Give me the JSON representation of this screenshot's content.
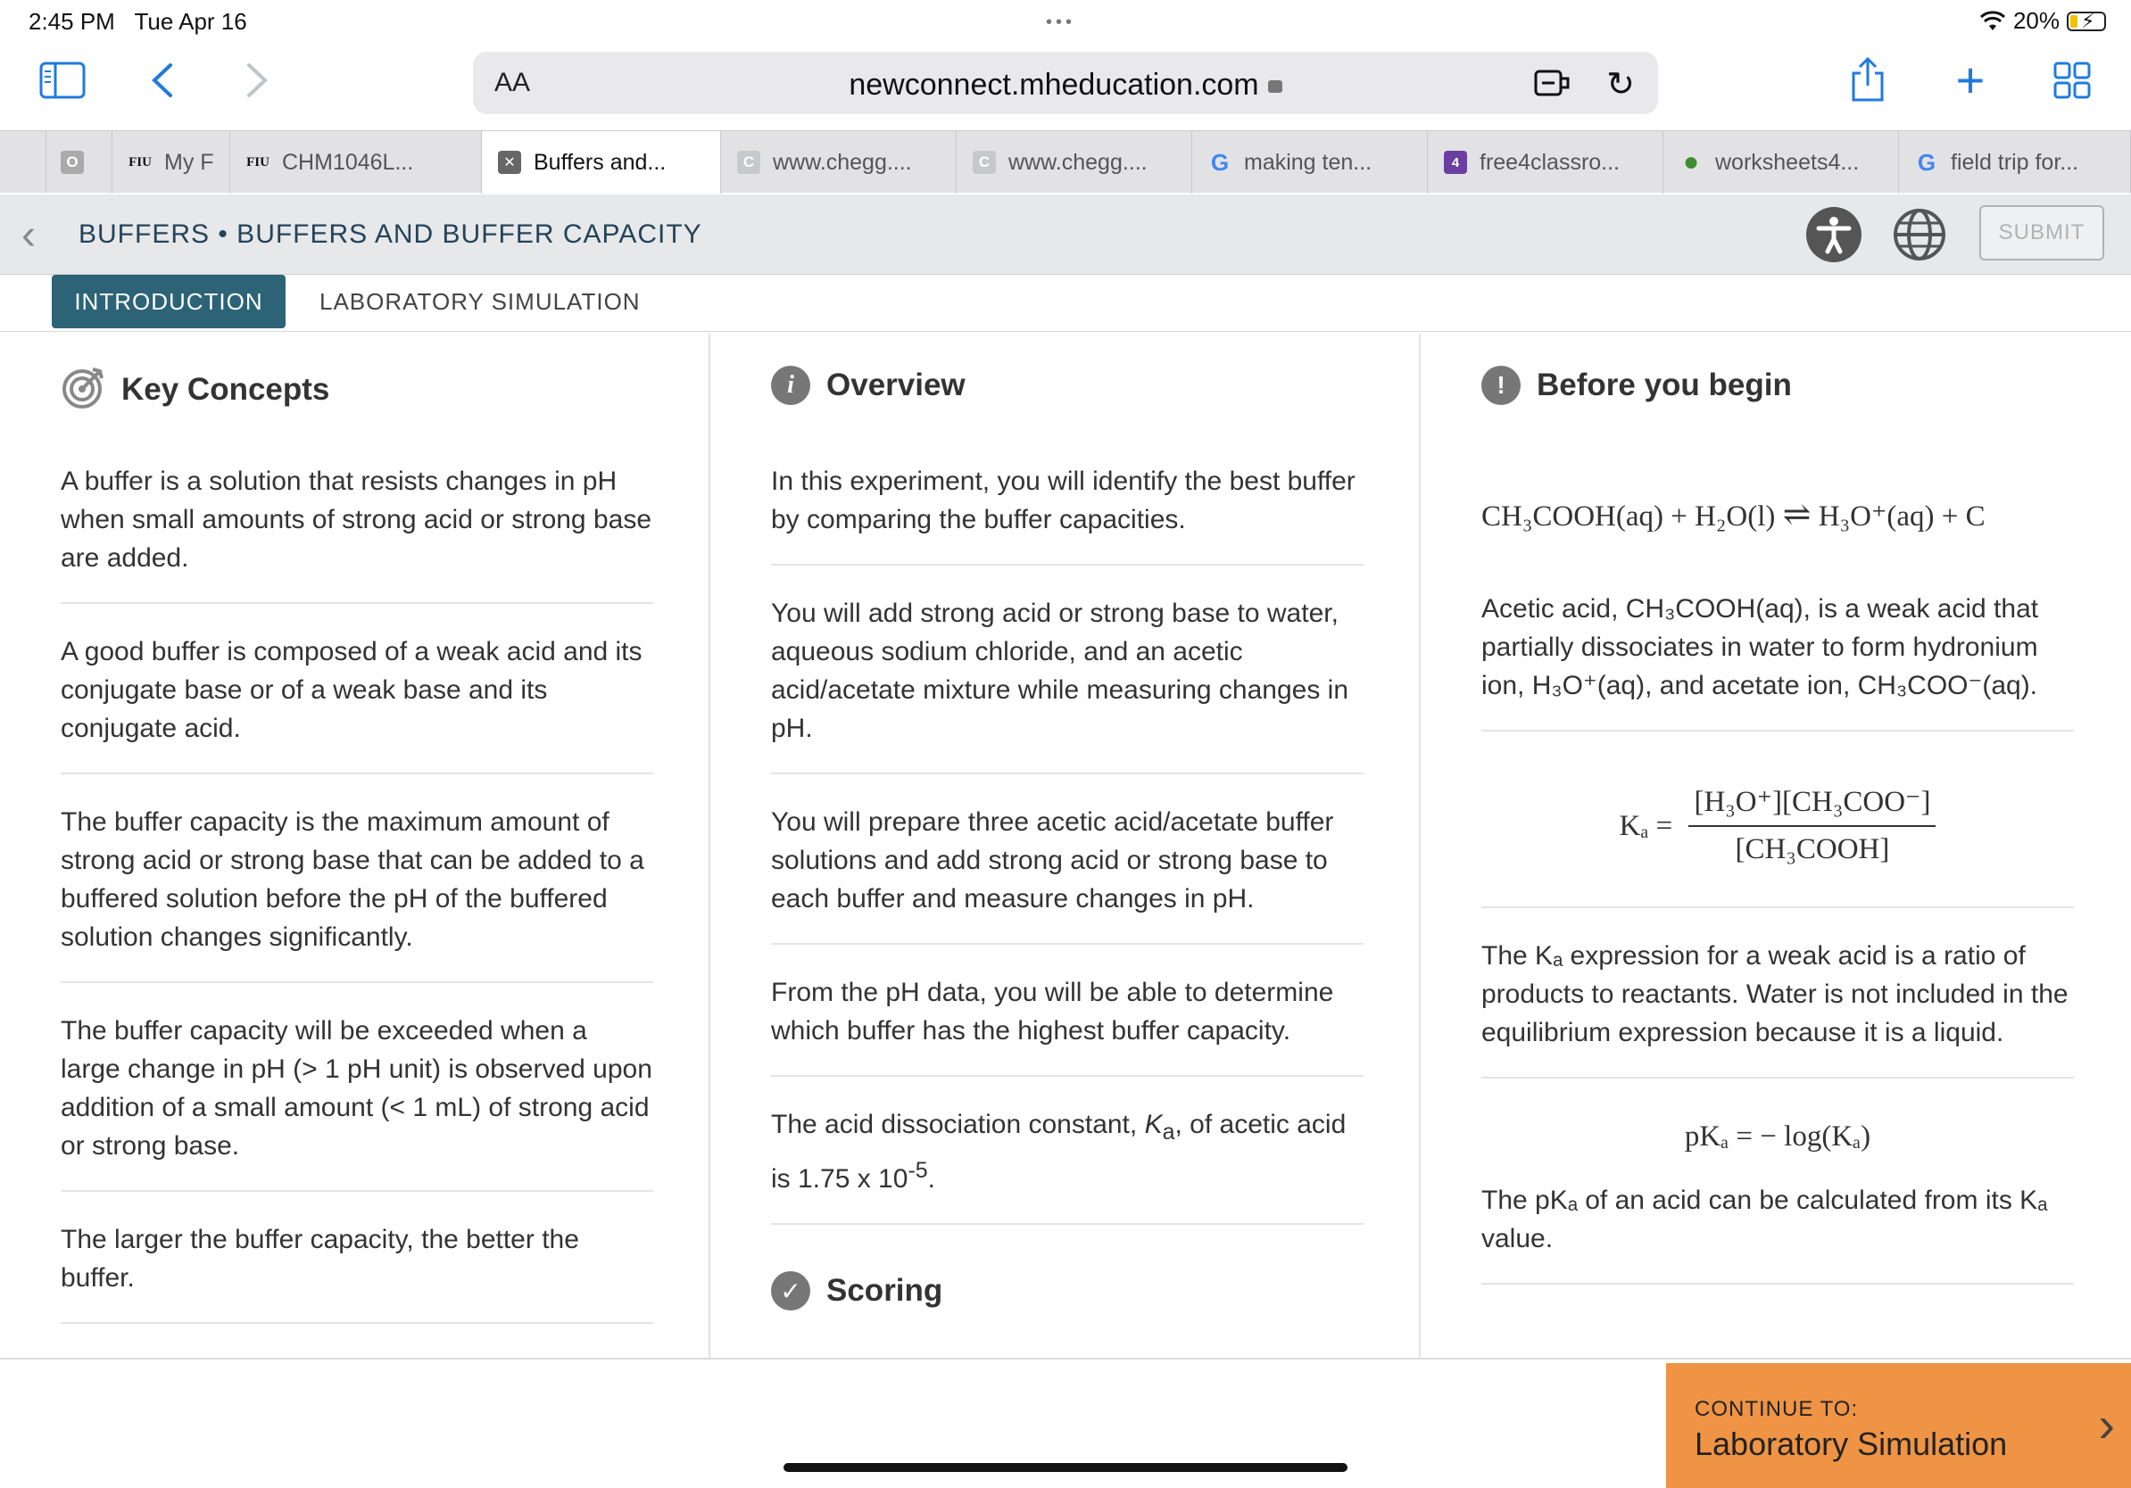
{
  "status": {
    "time": "2:45 PM",
    "date": "Tue Apr 16",
    "battery": "20%"
  },
  "browser": {
    "aa_label": "AA",
    "url": "newconnect.mheducation.com",
    "tabs": [
      {
        "favicon": "O",
        "label": ""
      },
      {
        "favicon": "FIU",
        "label": "My F"
      },
      {
        "favicon": "FIU",
        "label": "CHM1046L..."
      },
      {
        "favicon": "✕",
        "label": "Buffers and...",
        "active": true
      },
      {
        "favicon": "C",
        "label": "www.chegg...."
      },
      {
        "favicon": "C",
        "label": "www.chegg...."
      },
      {
        "favicon": "G",
        "label": "making ten..."
      },
      {
        "favicon": "4",
        "label": "free4classro..."
      },
      {
        "favicon": "●",
        "label": "worksheets4..."
      },
      {
        "favicon": "G",
        "label": "field trip for..."
      }
    ]
  },
  "page": {
    "title": "BUFFERS • BUFFERS AND BUFFER CAPACITY",
    "submit": "SUBMIT",
    "subtabs": {
      "intro": "INTRODUCTION",
      "lab": "LABORATORY SIMULATION"
    }
  },
  "key_concepts": {
    "heading": "Key Concepts",
    "items": [
      "A buffer is a solution that resists changes in pH when small amounts of strong acid or strong base are added.",
      "A good buffer is composed of a weak acid and its conjugate base or of a weak base and its conjugate acid.",
      "The buffer capacity is the maximum amount of strong acid or strong base that can be added to a buffered solution before the pH of the buffered solution changes significantly.",
      "The buffer capacity will be exceeded when a large change in pH (> 1 pH unit) is observed upon addition of a small amount (< 1 mL) of strong acid or strong base.",
      "The larger the buffer capacity, the better the buffer."
    ]
  },
  "overview": {
    "heading": "Overview",
    "items": [
      "In this experiment, you will identify the best buffer by comparing the buffer capacities.",
      "You will add strong acid or strong base to water, aqueous sodium chloride, and an acetic acid/acetate mixture while measuring changes in pH.",
      "You will prepare three acetic acid/acetate buffer solutions and add strong acid or strong base to each buffer and measure changes in pH.",
      "From the pH data, you will be able to determine which buffer has the highest buffer capacity."
    ],
    "ka_sentence": {
      "part1": "The acid dissociation constant, ",
      "ka_k": "K",
      "ka_sub": "a",
      "part2": ", of acetic acid is 1.75 x 10",
      "exp": "-5",
      "part3": "."
    },
    "scoring": "Scoring"
  },
  "before": {
    "heading": "Before you begin",
    "equation": {
      "left": "CH₃COOH(aq) + H₂O(l)",
      "arrow": "⇌",
      "right": "H₃O⁺(aq) + C"
    },
    "acetic_text": "Acetic acid, CH₃COOH(aq), is a weak acid that partially dissociates in water to form hydronium ion, H₃O⁺(aq), and acetate ion, CH₃COO⁻(aq).",
    "ka_formula": {
      "lhs": "Kₐ =",
      "num": "[H₃O⁺][CH₃COO⁻]",
      "den": "[CH₃COOH]"
    },
    "ka_expression_text": "The Kₐ expression for a weak acid is a ratio of products to reactants. Water is not included in the equilibrium expression because it is a liquid.",
    "pka_formula": "pKₐ = − log(Kₐ)",
    "pka_text": "The pKₐ of an acid can be calculated from its Kₐ value."
  },
  "footer": {
    "continue_small": "CONTINUE TO:",
    "continue_big": "Laboratory Simulation"
  },
  "colors": {
    "accent": "#2c6377",
    "continue": "#ef9444",
    "safari_blue": "#1f7ae0"
  }
}
